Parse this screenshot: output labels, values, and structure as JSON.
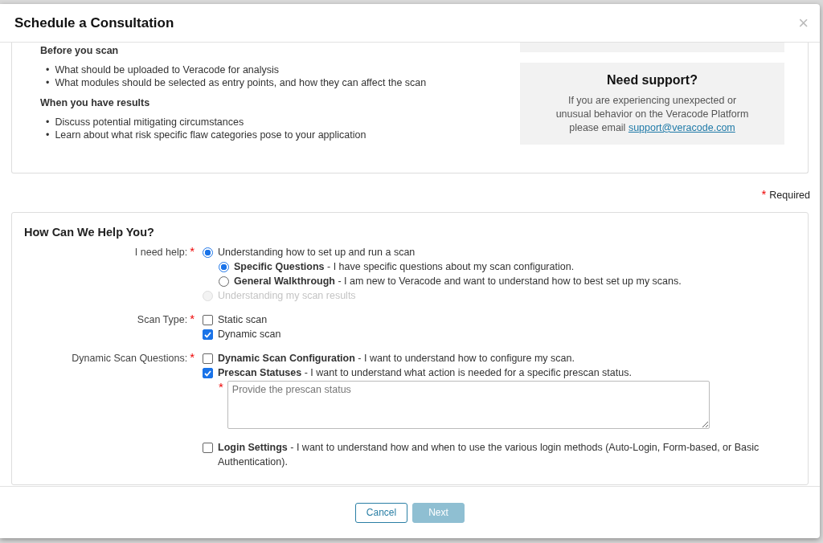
{
  "dialog": {
    "title": "Schedule a Consultation",
    "close": "×"
  },
  "intro": {
    "bullet": "•",
    "sections": [
      {
        "heading": "Before you scan",
        "bullets": [
          "What should be uploaded to Veracode for analysis",
          "What modules should be selected as entry points, and how they can affect the scan"
        ]
      },
      {
        "heading": "When you have results",
        "bullets": [
          "Discuss potential mitigating circumstances",
          "Learn about what risk specific flaw categories pose to your application"
        ]
      }
    ],
    "support": {
      "title": "Need support?",
      "text": "If you are experiencing unexpected or unusual behavior on the Veracode Platform please email",
      "link": "support@veracode.com"
    }
  },
  "required_note": {
    "mark": "*",
    "text": "Required"
  },
  "form": {
    "title": "How Can We Help You?",
    "fields": [
      {
        "label": "I need help:",
        "required": true,
        "options": [
          {
            "kind": "radio",
            "text": "Understanding how to set up and run a scan",
            "selected": true,
            "disabled": false,
            "children": [
              {
                "kind": "radio",
                "text": "**Specific Questions** - I have specific questions about my scan configuration.",
                "selected": true,
                "disabled": false
              },
              {
                "kind": "radio",
                "text": "**General Walkthrough** - I am new to Veracode and want to understand how to best set up my scans.",
                "selected": false,
                "disabled": false
              }
            ]
          },
          {
            "kind": "radio",
            "text": "Understanding my scan results",
            "selected": false,
            "disabled": true
          }
        ]
      },
      {
        "label": "Scan Type:",
        "required": true,
        "options": [
          {
            "kind": "checkbox",
            "text": "Static scan",
            "checked": false
          },
          {
            "kind": "checkbox",
            "text": "Dynamic scan",
            "checked": true
          }
        ]
      },
      {
        "label": "Dynamic Scan Questions:",
        "required": true,
        "options": [
          {
            "kind": "checkbox",
            "text": "**Dynamic Scan Configuration** - I want to understand how to configure my scan.",
            "checked": false
          },
          {
            "kind": "checkbox",
            "text": "**Prescan Statuses** - I want to understand what action is needed for a specific prescan status.",
            "checked": true
          },
          {
            "kind": "textarea",
            "placeholder": "Provide the prescan status",
            "required": true
          },
          {
            "kind": "checkbox",
            "text": "**Login Settings** - I want to understand how and when to use the various login methods (Auto-Login, Form-based, or Basic Authentication).",
            "checked": false
          }
        ]
      }
    ]
  },
  "buttons": [
    {
      "label": "Cancel",
      "disabled": false
    },
    {
      "label": "Next",
      "disabled": true
    }
  ]
}
